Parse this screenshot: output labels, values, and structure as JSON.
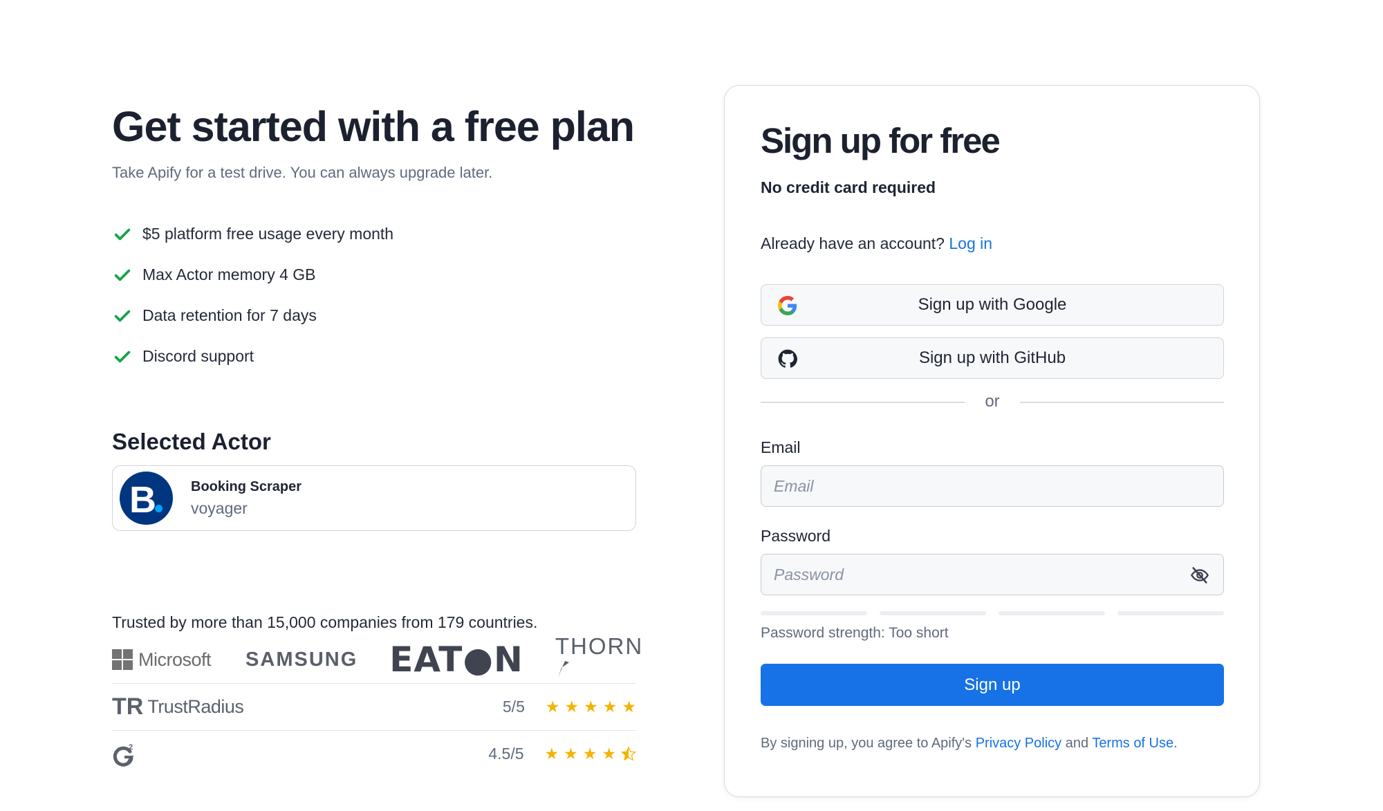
{
  "left": {
    "headline": "Get started with a free plan",
    "subhead": "Take Apify for a test drive. You can always upgrade later.",
    "features": [
      "$5 platform free usage every month",
      "Max Actor memory 4 GB",
      "Data retention for 7 days",
      "Discord support"
    ],
    "selected_actor_title": "Selected Actor",
    "actor": {
      "name": "Booking Scraper",
      "author": "voyager",
      "logo_letter": "B"
    },
    "trusted_text": "Trusted by more than 15,000 companies from 179 countries.",
    "company_logos": {
      "microsoft": "Microsoft",
      "samsung": "SAMSUNG",
      "eaton": "EAT●N",
      "thorn": "THORN"
    },
    "ratings": [
      {
        "site": "TrustRadius",
        "score": "5/5",
        "stars": 5
      },
      {
        "site": "G2",
        "score": "4.5/5",
        "stars": 4.5
      }
    ]
  },
  "card": {
    "title": "Sign up for free",
    "subtitle": "No credit card required",
    "have_account": "Already have an account?",
    "login_link": "Log in",
    "google_button": "Sign up with Google",
    "github_button": "Sign up with GitHub",
    "divider_text": "or",
    "email_label": "Email",
    "email_placeholder": "Email",
    "password_label": "Password",
    "password_placeholder": "Password",
    "password_strength": "Password strength: Too short",
    "signup_button": "Sign up",
    "terms_prefix": "By signing up, you agree to Apify's",
    "privacy_link": "Privacy Policy",
    "terms_and": "and",
    "terms_link": "Terms of Use",
    "terms_suffix": "."
  },
  "colors": {
    "accent": "#1672e6",
    "check_green": "#16a34a",
    "star_gold": "#f5b301",
    "booking_blue": "#003580"
  }
}
